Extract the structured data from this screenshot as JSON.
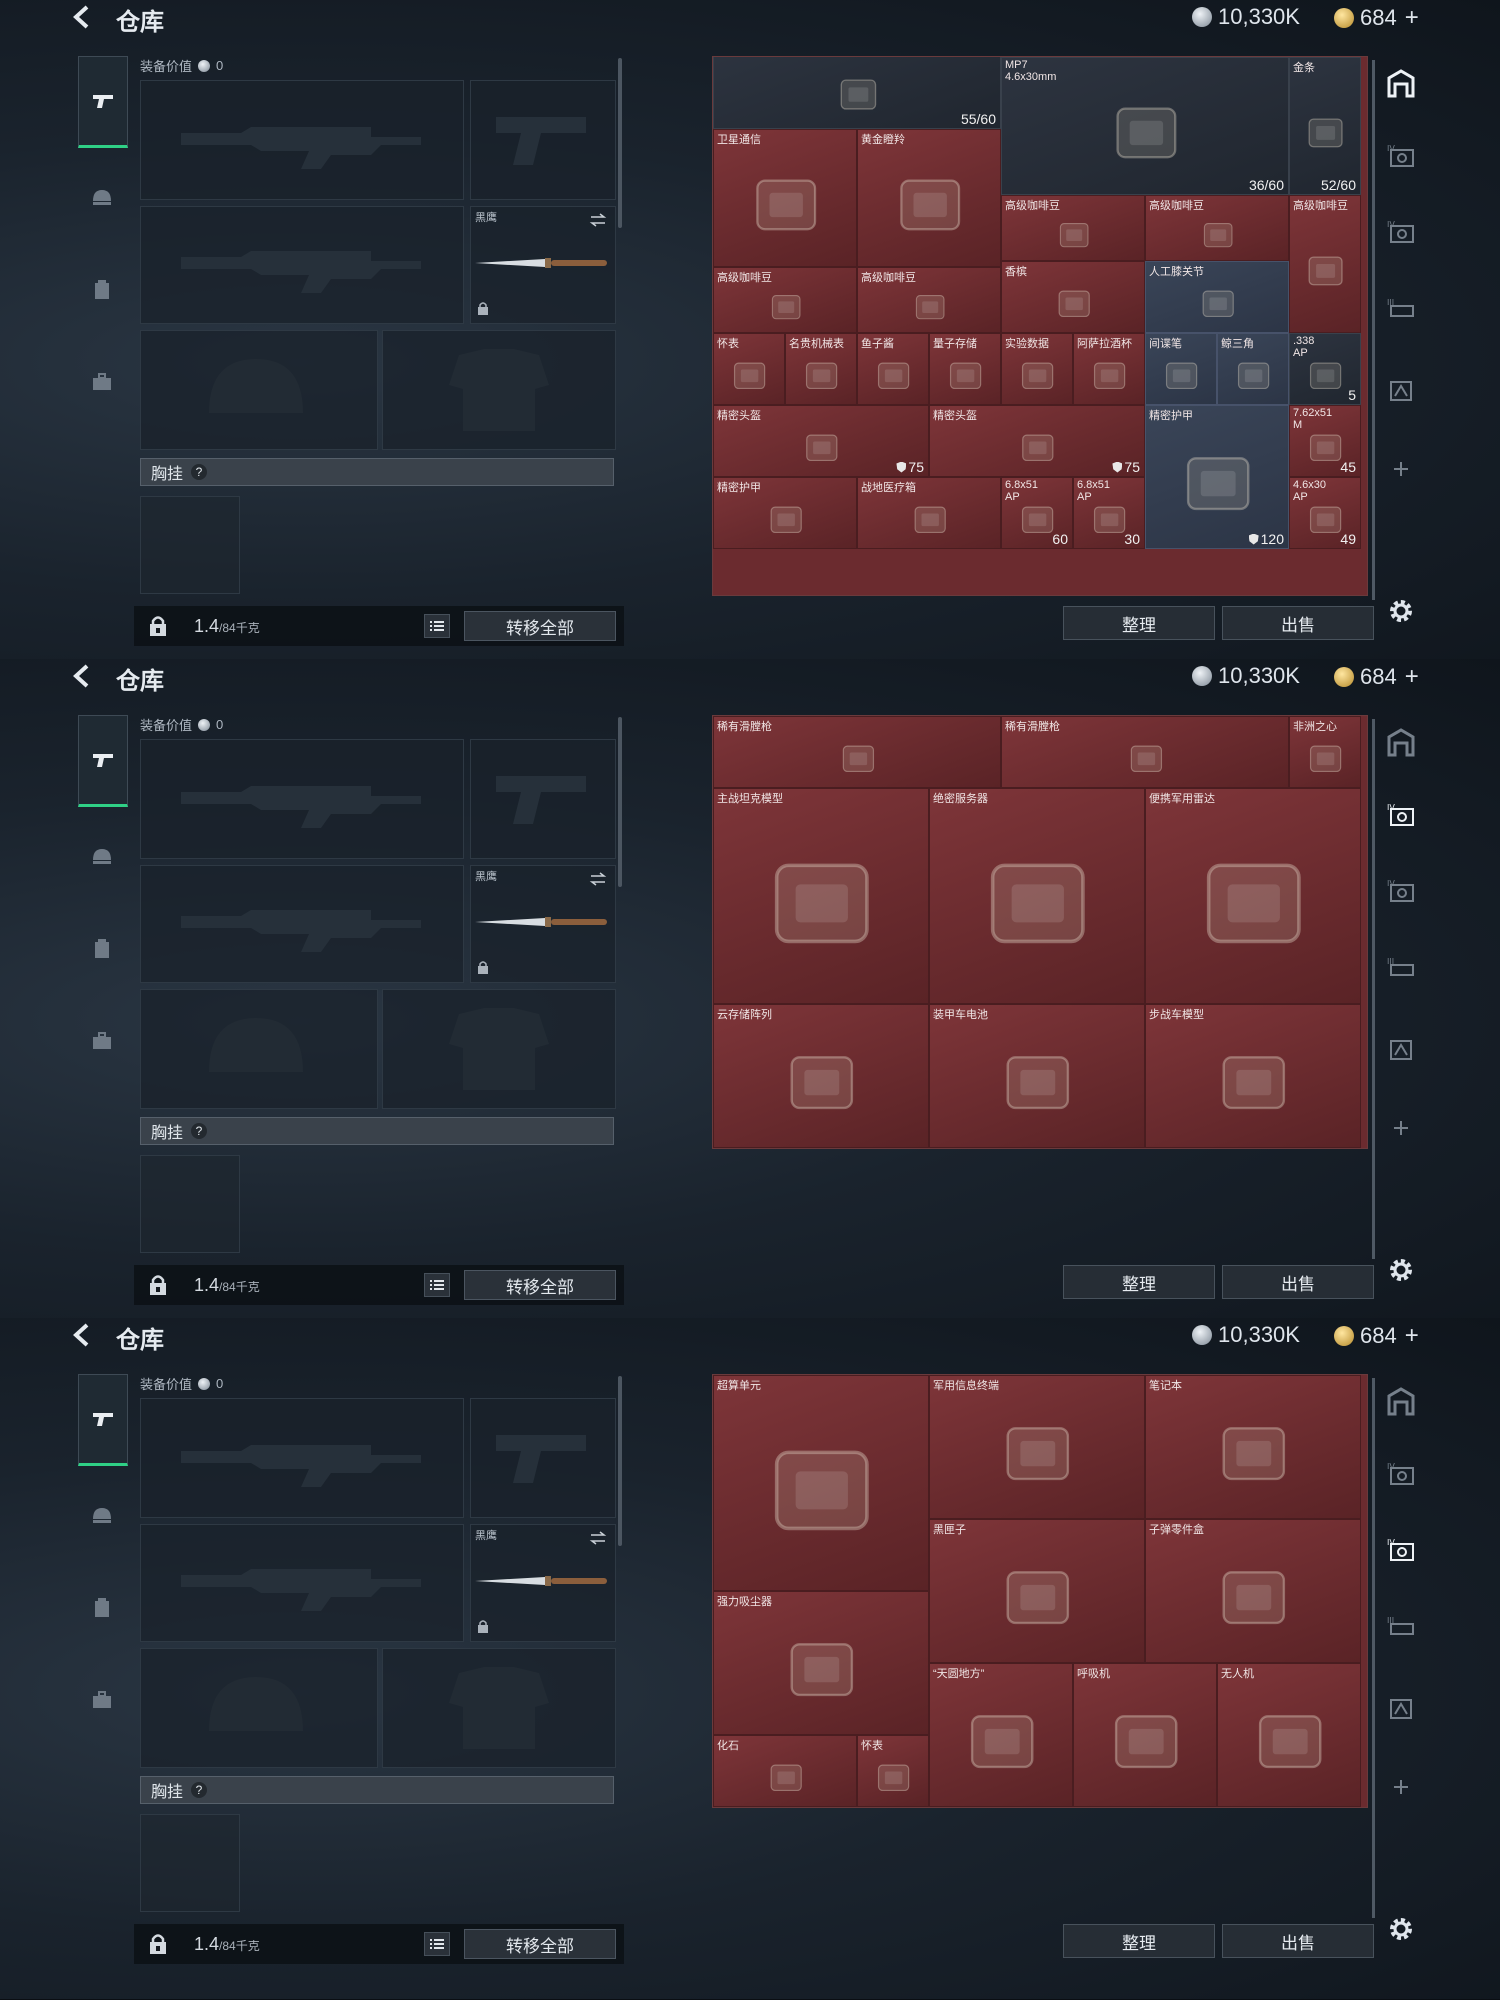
{
  "header": {
    "title": "仓库",
    "silver_amount": "10,330K",
    "gold_amount": "684",
    "gold_plus": "+"
  },
  "loadout": {
    "equip_value_label": "装备价值",
    "equip_value": "0",
    "knife_label": "黑鹰",
    "chest_label": "胸挂",
    "chest_help": "?",
    "weight_value": "1.4",
    "weight_unit": "/84千克",
    "transfer_all": "转移全部"
  },
  "actions": {
    "sort": "整理",
    "sell": "出售"
  },
  "panel1": {
    "cells": [
      {
        "name": "",
        "count": "55/60"
      },
      {
        "name": "MP7",
        "sub": "4.6x30mm",
        "count": "36/60"
      },
      {
        "name": "金条",
        "count": "52/60"
      },
      {
        "name": "卫星通信"
      },
      {
        "name": "黄金瞪羚"
      },
      {
        "name": "高级咖啡豆"
      },
      {
        "name": "高级咖啡豆"
      },
      {
        "name": "高级咖啡豆"
      },
      {
        "name": "高级咖啡豆"
      },
      {
        "name": "高级咖啡豆"
      },
      {
        "name": "香槟"
      },
      {
        "name": "人工膝关节"
      },
      {
        "name": "怀表"
      },
      {
        "name": "名贵机械表"
      },
      {
        "name": "鱼子酱"
      },
      {
        "name": "量子存储"
      },
      {
        "name": "实验数据"
      },
      {
        "name": "阿萨拉酒杯"
      },
      {
        "name": "间谍笔"
      },
      {
        "name": "鲸三角"
      },
      {
        "name": ".338",
        "sub": "AP",
        "count": "5"
      },
      {
        "name": "精密头盔",
        "durability": "75"
      },
      {
        "name": "精密头盔",
        "durability": "75"
      },
      {
        "name": "精密护甲",
        "durability": "120"
      },
      {
        "name": "7.62x51",
        "sub": "M",
        "count": "45"
      },
      {
        "name": "精密护甲"
      },
      {
        "name": "战地医疗箱"
      },
      {
        "name": "6.8x51",
        "sub": "AP",
        "count": "60"
      },
      {
        "name": "6.8x51",
        "sub": "AP",
        "count": "30"
      },
      {
        "name": "4.6x30",
        "sub": "AP",
        "count": "49"
      }
    ]
  },
  "panel2": {
    "cells": [
      {
        "name": "稀有滑膛枪"
      },
      {
        "name": "稀有滑膛枪"
      },
      {
        "name": "非洲之心"
      },
      {
        "name": "主战坦克模型"
      },
      {
        "name": "绝密服务器"
      },
      {
        "name": "便携军用雷达"
      },
      {
        "name": "云存储阵列"
      },
      {
        "name": "装甲车电池"
      },
      {
        "name": "步战车模型"
      }
    ]
  },
  "panel3": {
    "cells": [
      {
        "name": "超算单元"
      },
      {
        "name": "军用信息终端"
      },
      {
        "name": "笔记本"
      },
      {
        "name": "黑匣子"
      },
      {
        "name": "子弹零件盒"
      },
      {
        "name": "强力吸尘器"
      },
      {
        "name": "“天圆地方”"
      },
      {
        "name": "呼吸机"
      },
      {
        "name": "无人机"
      },
      {
        "name": "化石"
      },
      {
        "name": "怀表"
      }
    ]
  },
  "colors": {
    "accent_green": "#2fd086",
    "cell_red": "#6b2b2f",
    "panel_bg": "#1a232d"
  }
}
